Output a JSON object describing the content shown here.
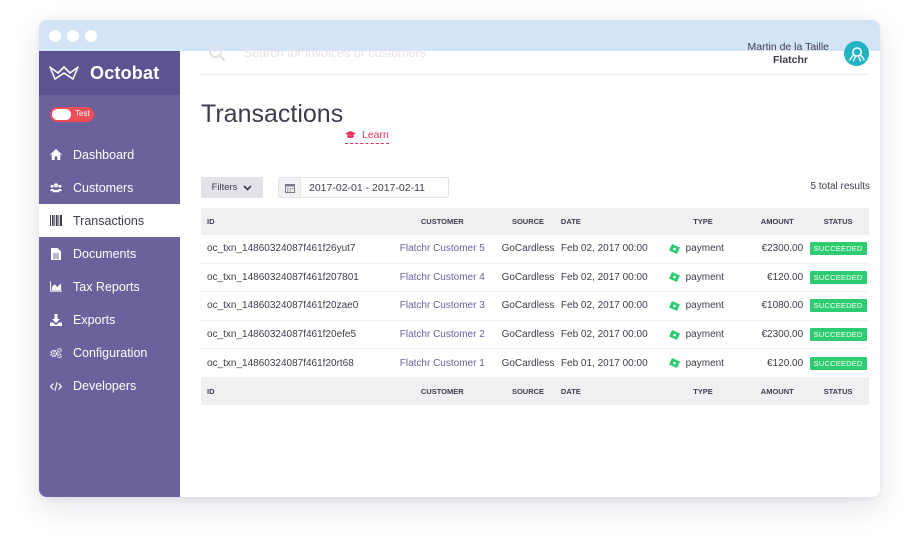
{
  "app": {
    "brand": "Octobat",
    "mode_toggle_label": "Test"
  },
  "colors": {
    "sidebar": "#6b619c",
    "brand_bar": "#5d5390",
    "titlebar": "#d3e4f7",
    "accent_pink": "#e8305b",
    "success": "#2ecc71",
    "avatar": "#20b3c4"
  },
  "sidebar": {
    "items": [
      {
        "label": "Dashboard",
        "icon": "home-icon",
        "active": false
      },
      {
        "label": "Customers",
        "icon": "users-icon",
        "active": false
      },
      {
        "label": "Transactions",
        "icon": "barcode-icon",
        "active": true
      },
      {
        "label": "Documents",
        "icon": "document-icon",
        "active": false
      },
      {
        "label": "Tax Reports",
        "icon": "area-chart-icon",
        "active": false
      },
      {
        "label": "Exports",
        "icon": "download-icon",
        "active": false
      },
      {
        "label": "Configuration",
        "icon": "gears-icon",
        "active": false
      },
      {
        "label": "Developers",
        "icon": "code-icon",
        "active": false
      }
    ]
  },
  "header": {
    "search_placeholder": "Search for invoices or customers",
    "user_name": "Martin de la Taille",
    "user_org": "Flatchr"
  },
  "main": {
    "title": "Transactions",
    "learn_label": "Learn",
    "filters_label": "Filters",
    "date_range": "2017-02-01 - 2017-02-11",
    "total_results": "5 total results"
  },
  "table": {
    "columns": [
      "ID",
      "CUSTOMER",
      "SOURCE",
      "DATE",
      "TYPE",
      "AMOUNT",
      "STATUS"
    ],
    "rows": [
      {
        "id": "oc_txn_14860324087f461f26yut7",
        "customer": "Flatchr Customer 5",
        "source": "GoCardless",
        "date": "Feb 02, 2017 00:00",
        "type": "payment",
        "amount": "€2300.00",
        "status": "SUCCEEDED"
      },
      {
        "id": "oc_txn_14860324087f461f207801",
        "customer": "Flatchr Customer 4",
        "source": "GoCardless",
        "date": "Feb 02, 2017 00:00",
        "type": "payment",
        "amount": "€120.00",
        "status": "SUCCEEDED"
      },
      {
        "id": "oc_txn_14860324087f461f20zae0",
        "customer": "Flatchr Customer 3",
        "source": "GoCardless",
        "date": "Feb 02, 2017 00:00",
        "type": "payment",
        "amount": "€1080.00",
        "status": "SUCCEEDED"
      },
      {
        "id": "oc_txn_14860324087f461f20efe5",
        "customer": "Flatchr Customer 2",
        "source": "GoCardless",
        "date": "Feb 02, 2017 00:00",
        "type": "payment",
        "amount": "€2300.00",
        "status": "SUCCEEDED"
      },
      {
        "id": "oc_txn_14860324087f461f20rt68",
        "customer": "Flatchr Customer 1",
        "source": "GoCardless",
        "date": "Feb 01, 2017 00:00",
        "type": "payment",
        "amount": "€120.00",
        "status": "SUCCEEDED"
      }
    ]
  }
}
